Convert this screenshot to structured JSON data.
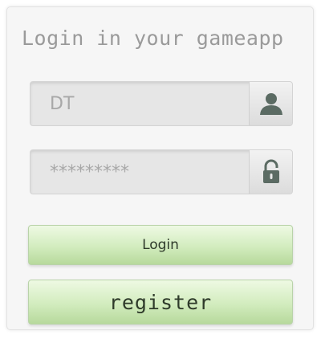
{
  "form": {
    "title": "Login in your gameapp",
    "username": {
      "value": "DT",
      "icon": "user-icon"
    },
    "password": {
      "value": "*********",
      "icon": "lock-icon"
    },
    "login_label": "Login",
    "register_label": "register"
  },
  "colors": {
    "button_top": "#eef9e3",
    "button_bottom": "#b7d99c",
    "icon": "#5b6b63",
    "title_text": "#9a9a9a"
  }
}
